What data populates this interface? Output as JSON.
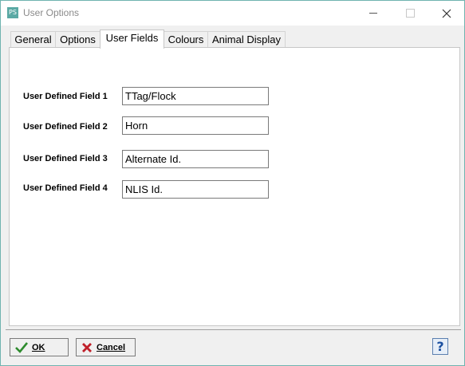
{
  "window": {
    "title": "User Options",
    "app_icon_text": "PS"
  },
  "tabs": [
    {
      "label": "General",
      "active": false
    },
    {
      "label": "Options",
      "active": false
    },
    {
      "label": "User Fields",
      "active": true
    },
    {
      "label": "Colours",
      "active": false
    },
    {
      "label": "Animal Display",
      "active": false
    }
  ],
  "fields": [
    {
      "label": "User Defined Field 1",
      "value": "TTag/Flock"
    },
    {
      "label": "User Defined Field 2",
      "value": "Horn"
    },
    {
      "label": "User Defined Field 3",
      "value": "Alternate Id."
    },
    {
      "label": "User Defined Field 4",
      "value": "NLIS Id."
    }
  ],
  "buttons": {
    "ok_label": "OK",
    "cancel_label": "Cancel",
    "help_label": "?"
  },
  "colors": {
    "ok_check": "#2e8b2e",
    "cancel_x": "#c0202a",
    "help": "#1a4fa0",
    "accent": "#6fb4b0"
  }
}
